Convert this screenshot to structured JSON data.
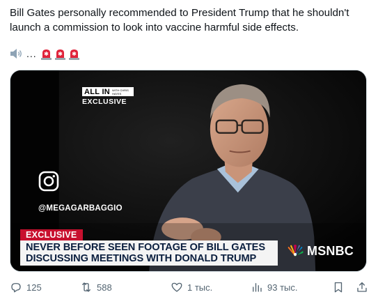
{
  "post": {
    "text": "Bill Gates personally recommended to President Trump that he shouldn't launch a commission to look into vaccine harmful side effects.",
    "emoji_line": {
      "icons": [
        "speaker-icon",
        "police-light-icon",
        "police-light-icon",
        "police-light-icon"
      ],
      "dots": "..."
    }
  },
  "media": {
    "overlay_brand": "ALL IN",
    "overlay_brand_sub": "WITH CHRIS HAYES",
    "overlay_exclusive": "EXCLUSIVE",
    "instagram_handle": "@MEGAGARBAGGIO",
    "lower_third_tag": "EXCLUSIVE",
    "headline_line1": "NEVER BEFORE SEEN FOOTAGE OF BILL GATES",
    "headline_line2": "DISCUSSING MEETINGS WITH DONALD TRUMP",
    "network": "MSNBC",
    "colors": {
      "tag_red": "#c8102e",
      "headline_navy": "#0b1f3f"
    }
  },
  "actions": {
    "reply_count": "125",
    "repost_count": "588",
    "like_count": "1 тыс.",
    "views_count": "93 тыс."
  }
}
